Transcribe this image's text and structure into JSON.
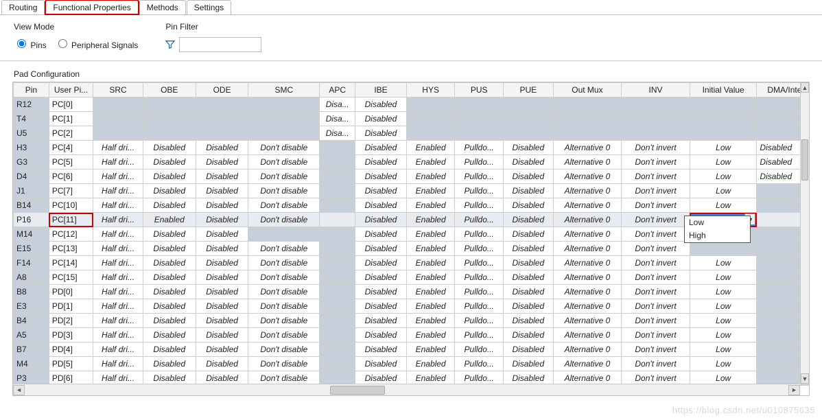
{
  "tabs": [
    "Routing",
    "Functional Properties",
    "Methods",
    "Settings"
  ],
  "active_tab": 1,
  "highlight_tab": 1,
  "view_mode": {
    "title": "View Mode",
    "options": [
      "Pins",
      "Peripheral Signals"
    ],
    "selected": 0
  },
  "pin_filter": {
    "title": "Pin Filter",
    "value": "",
    "placeholder": ""
  },
  "section_title": "Pad Configuration",
  "columns": [
    "Pin",
    "User Pi...",
    "SRC",
    "OBE",
    "ODE",
    "SMC",
    "APC",
    "IBE",
    "HYS",
    "PUS",
    "PUE",
    "Out Mux",
    "INV",
    "Initial Value",
    "DMA/Interru"
  ],
  "rows": [
    {
      "pin": "R12",
      "upin": "PC[0]",
      "src": "",
      "obe": "",
      "ode": "",
      "smc": "",
      "apc": "Disa...",
      "ibe": "Disabled",
      "hys": "",
      "pus": "",
      "pue": "",
      "mux": "",
      "inv": "",
      "iv": "",
      "dma": "",
      "hl": false,
      "sel": false,
      "shaded": true
    },
    {
      "pin": "T4",
      "upin": "PC[1]",
      "src": "",
      "obe": "",
      "ode": "",
      "smc": "",
      "apc": "Disa...",
      "ibe": "Disabled",
      "hys": "",
      "pus": "",
      "pue": "",
      "mux": "",
      "inv": "",
      "iv": "",
      "dma": "",
      "hl": false,
      "sel": false,
      "shaded": true
    },
    {
      "pin": "U5",
      "upin": "PC[2]",
      "src": "",
      "obe": "",
      "ode": "",
      "smc": "",
      "apc": "Disa...",
      "ibe": "Disabled",
      "hys": "",
      "pus": "",
      "pue": "",
      "mux": "",
      "inv": "",
      "iv": "",
      "dma": "",
      "hl": false,
      "sel": false,
      "shaded": true
    },
    {
      "pin": "H3",
      "upin": "PC[4]",
      "src": "Half dri...",
      "obe": "Disabled",
      "ode": "Disabled",
      "smc": "Don't disable",
      "apc": "",
      "ibe": "Disabled",
      "hys": "Enabled",
      "pus": "Pulldo...",
      "pue": "Disabled",
      "mux": "Alternative 0",
      "inv": "Don't invert",
      "iv": "Low",
      "dma": "Disabled",
      "hl": false,
      "sel": false,
      "shaded": false
    },
    {
      "pin": "G3",
      "upin": "PC[5]",
      "src": "Half dri...",
      "obe": "Disabled",
      "ode": "Disabled",
      "smc": "Don't disable",
      "apc": "",
      "ibe": "Disabled",
      "hys": "Enabled",
      "pus": "Pulldo...",
      "pue": "Disabled",
      "mux": "Alternative 0",
      "inv": "Don't invert",
      "iv": "Low",
      "dma": "Disabled",
      "hl": false,
      "sel": false,
      "shaded": false
    },
    {
      "pin": "D4",
      "upin": "PC[6]",
      "src": "Half dri...",
      "obe": "Disabled",
      "ode": "Disabled",
      "smc": "Don't disable",
      "apc": "",
      "ibe": "Disabled",
      "hys": "Enabled",
      "pus": "Pulldo...",
      "pue": "Disabled",
      "mux": "Alternative 0",
      "inv": "Don't invert",
      "iv": "Low",
      "dma": "Disabled",
      "hl": false,
      "sel": false,
      "shaded": false
    },
    {
      "pin": "J1",
      "upin": "PC[7]",
      "src": "Half dri...",
      "obe": "Disabled",
      "ode": "Disabled",
      "smc": "Don't disable",
      "apc": "",
      "ibe": "Disabled",
      "hys": "Enabled",
      "pus": "Pulldo...",
      "pue": "Disabled",
      "mux": "Alternative 0",
      "inv": "Don't invert",
      "iv": "Low",
      "dma": "",
      "hl": false,
      "sel": false,
      "shaded": false
    },
    {
      "pin": "B14",
      "upin": "PC[10]",
      "src": "Half dri...",
      "obe": "Disabled",
      "ode": "Disabled",
      "smc": "Don't disable",
      "apc": "",
      "ibe": "Disabled",
      "hys": "Enabled",
      "pus": "Pulldo...",
      "pue": "Disabled",
      "mux": "Alternative 0",
      "inv": "Don't invert",
      "iv": "Low",
      "dma": "",
      "hl": false,
      "sel": false,
      "shaded": false
    },
    {
      "pin": "P16",
      "upin": "PC[11]",
      "src": "Half dri...",
      "obe": "Enabled",
      "ode": "Disabled",
      "smc": "Don't disable",
      "apc": "",
      "ibe": "Disabled",
      "hys": "Enabled",
      "pus": "Pulldo...",
      "pue": "Disabled",
      "mux": "Alternative 0",
      "inv": "Don't invert",
      "iv": "High",
      "dma": "",
      "hl": true,
      "sel": true,
      "shaded": false
    },
    {
      "pin": "M14",
      "upin": "PC[12]",
      "src": "Half dri...",
      "obe": "Disabled",
      "ode": "Disabled",
      "smc": "",
      "apc": "",
      "ibe": "Disabled",
      "hys": "Enabled",
      "pus": "Pulldo...",
      "pue": "Disabled",
      "mux": "Alternative 0",
      "inv": "Don't invert",
      "iv": "",
      "dma": "",
      "hl": false,
      "sel": false,
      "shaded": false
    },
    {
      "pin": "E15",
      "upin": "PC[13]",
      "src": "Half dri...",
      "obe": "Disabled",
      "ode": "Disabled",
      "smc": "Don't disable",
      "apc": "",
      "ibe": "Disabled",
      "hys": "Enabled",
      "pus": "Pulldo...",
      "pue": "Disabled",
      "mux": "Alternative 0",
      "inv": "Don't invert",
      "iv": "",
      "dma": "",
      "hl": false,
      "sel": false,
      "shaded": false
    },
    {
      "pin": "F14",
      "upin": "PC[14]",
      "src": "Half dri...",
      "obe": "Disabled",
      "ode": "Disabled",
      "smc": "Don't disable",
      "apc": "",
      "ibe": "Disabled",
      "hys": "Enabled",
      "pus": "Pulldo...",
      "pue": "Disabled",
      "mux": "Alternative 0",
      "inv": "Don't invert",
      "iv": "Low",
      "dma": "",
      "hl": false,
      "sel": false,
      "shaded": false
    },
    {
      "pin": "A8",
      "upin": "PC[15]",
      "src": "Half dri...",
      "obe": "Disabled",
      "ode": "Disabled",
      "smc": "Don't disable",
      "apc": "",
      "ibe": "Disabled",
      "hys": "Enabled",
      "pus": "Pulldo...",
      "pue": "Disabled",
      "mux": "Alternative 0",
      "inv": "Don't invert",
      "iv": "Low",
      "dma": "",
      "hl": false,
      "sel": false,
      "shaded": false
    },
    {
      "pin": "B8",
      "upin": "PD[0]",
      "src": "Half dri...",
      "obe": "Disabled",
      "ode": "Disabled",
      "smc": "Don't disable",
      "apc": "",
      "ibe": "Disabled",
      "hys": "Enabled",
      "pus": "Pulldo...",
      "pue": "Disabled",
      "mux": "Alternative 0",
      "inv": "Don't invert",
      "iv": "Low",
      "dma": "",
      "hl": false,
      "sel": false,
      "shaded": false
    },
    {
      "pin": "E3",
      "upin": "PD[1]",
      "src": "Half dri...",
      "obe": "Disabled",
      "ode": "Disabled",
      "smc": "Don't disable",
      "apc": "",
      "ibe": "Disabled",
      "hys": "Enabled",
      "pus": "Pulldo...",
      "pue": "Disabled",
      "mux": "Alternative 0",
      "inv": "Don't invert",
      "iv": "Low",
      "dma": "",
      "hl": false,
      "sel": false,
      "shaded": false
    },
    {
      "pin": "B4",
      "upin": "PD[2]",
      "src": "Half dri...",
      "obe": "Disabled",
      "ode": "Disabled",
      "smc": "Don't disable",
      "apc": "",
      "ibe": "Disabled",
      "hys": "Enabled",
      "pus": "Pulldo...",
      "pue": "Disabled",
      "mux": "Alternative 0",
      "inv": "Don't invert",
      "iv": "Low",
      "dma": "",
      "hl": false,
      "sel": false,
      "shaded": false
    },
    {
      "pin": "A5",
      "upin": "PD[3]",
      "src": "Half dri...",
      "obe": "Disabled",
      "ode": "Disabled",
      "smc": "Don't disable",
      "apc": "",
      "ibe": "Disabled",
      "hys": "Enabled",
      "pus": "Pulldo...",
      "pue": "Disabled",
      "mux": "Alternative 0",
      "inv": "Don't invert",
      "iv": "Low",
      "dma": "",
      "hl": false,
      "sel": false,
      "shaded": false
    },
    {
      "pin": "B7",
      "upin": "PD[4]",
      "src": "Half dri...",
      "obe": "Disabled",
      "ode": "Disabled",
      "smc": "Don't disable",
      "apc": "",
      "ibe": "Disabled",
      "hys": "Enabled",
      "pus": "Pulldo...",
      "pue": "Disabled",
      "mux": "Alternative 0",
      "inv": "Don't invert",
      "iv": "Low",
      "dma": "",
      "hl": false,
      "sel": false,
      "shaded": false
    },
    {
      "pin": "M4",
      "upin": "PD[5]",
      "src": "Half dri...",
      "obe": "Disabled",
      "ode": "Disabled",
      "smc": "Don't disable",
      "apc": "",
      "ibe": "Disabled",
      "hys": "Enabled",
      "pus": "Pulldo...",
      "pue": "Disabled",
      "mux": "Alternative 0",
      "inv": "Don't invert",
      "iv": "Low",
      "dma": "",
      "hl": false,
      "sel": false,
      "shaded": false
    },
    {
      "pin": "P3",
      "upin": "PD[6]",
      "src": "Half dri...",
      "obe": "Disabled",
      "ode": "Disabled",
      "smc": "Don't disable",
      "apc": "",
      "ibe": "Disabled",
      "hys": "Enabled",
      "pus": "Pulldo...",
      "pue": "Disabled",
      "mux": "Alternative 0",
      "inv": "Don't invert",
      "iv": "Low",
      "dma": "",
      "hl": false,
      "sel": false,
      "shaded": false
    }
  ],
  "dropdown": {
    "options": [
      "Low",
      "High"
    ],
    "selected": "High"
  },
  "watermark": "https://blog.csdn.net/u010875635"
}
